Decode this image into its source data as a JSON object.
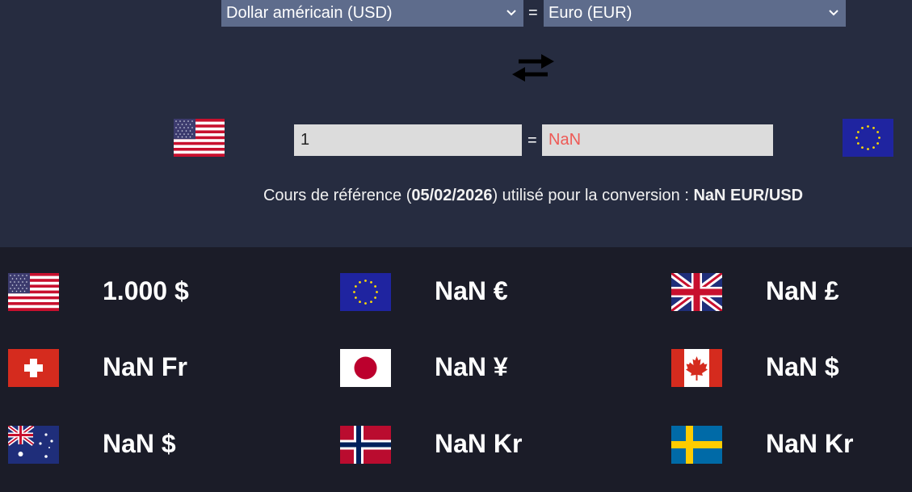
{
  "converter": {
    "from_currency": "Dollar américain (USD)",
    "to_currency": "Euro (EUR)",
    "equals_sign": "=",
    "amount_value": "1",
    "result_value": "NaN",
    "result_color": "#ee5a56",
    "from_flag": "us-flag-icon",
    "to_flag": "eu-flag-icon",
    "swap_icon": "swap-arrows-icon",
    "rate": {
      "prefix": "Cours de référence (",
      "date": "05/02/2026",
      "middle": ") utilisé pour la conversion : ",
      "value": "NaN EUR/USD"
    }
  },
  "conversions": [
    {
      "flag": "us-flag-icon",
      "value": "1.000 $"
    },
    {
      "flag": "eu-flag-icon",
      "value": "NaN €"
    },
    {
      "flag": "uk-flag-icon",
      "value": "NaN £"
    },
    {
      "flag": "ch-flag-icon",
      "value": "NaN Fr"
    },
    {
      "flag": "jp-flag-icon",
      "value": "NaN ¥"
    },
    {
      "flag": "ca-flag-icon",
      "value": "NaN $"
    },
    {
      "flag": "au-flag-icon",
      "value": "NaN $"
    },
    {
      "flag": "no-flag-icon",
      "value": "NaN Kr"
    },
    {
      "flag": "se-flag-icon",
      "value": "NaN Kr"
    }
  ],
  "colors": {
    "top_background": "#262c40",
    "bottom_background": "#1b1c28",
    "select_background": "#5e6c8c",
    "input_background": "#dcdcdc"
  }
}
